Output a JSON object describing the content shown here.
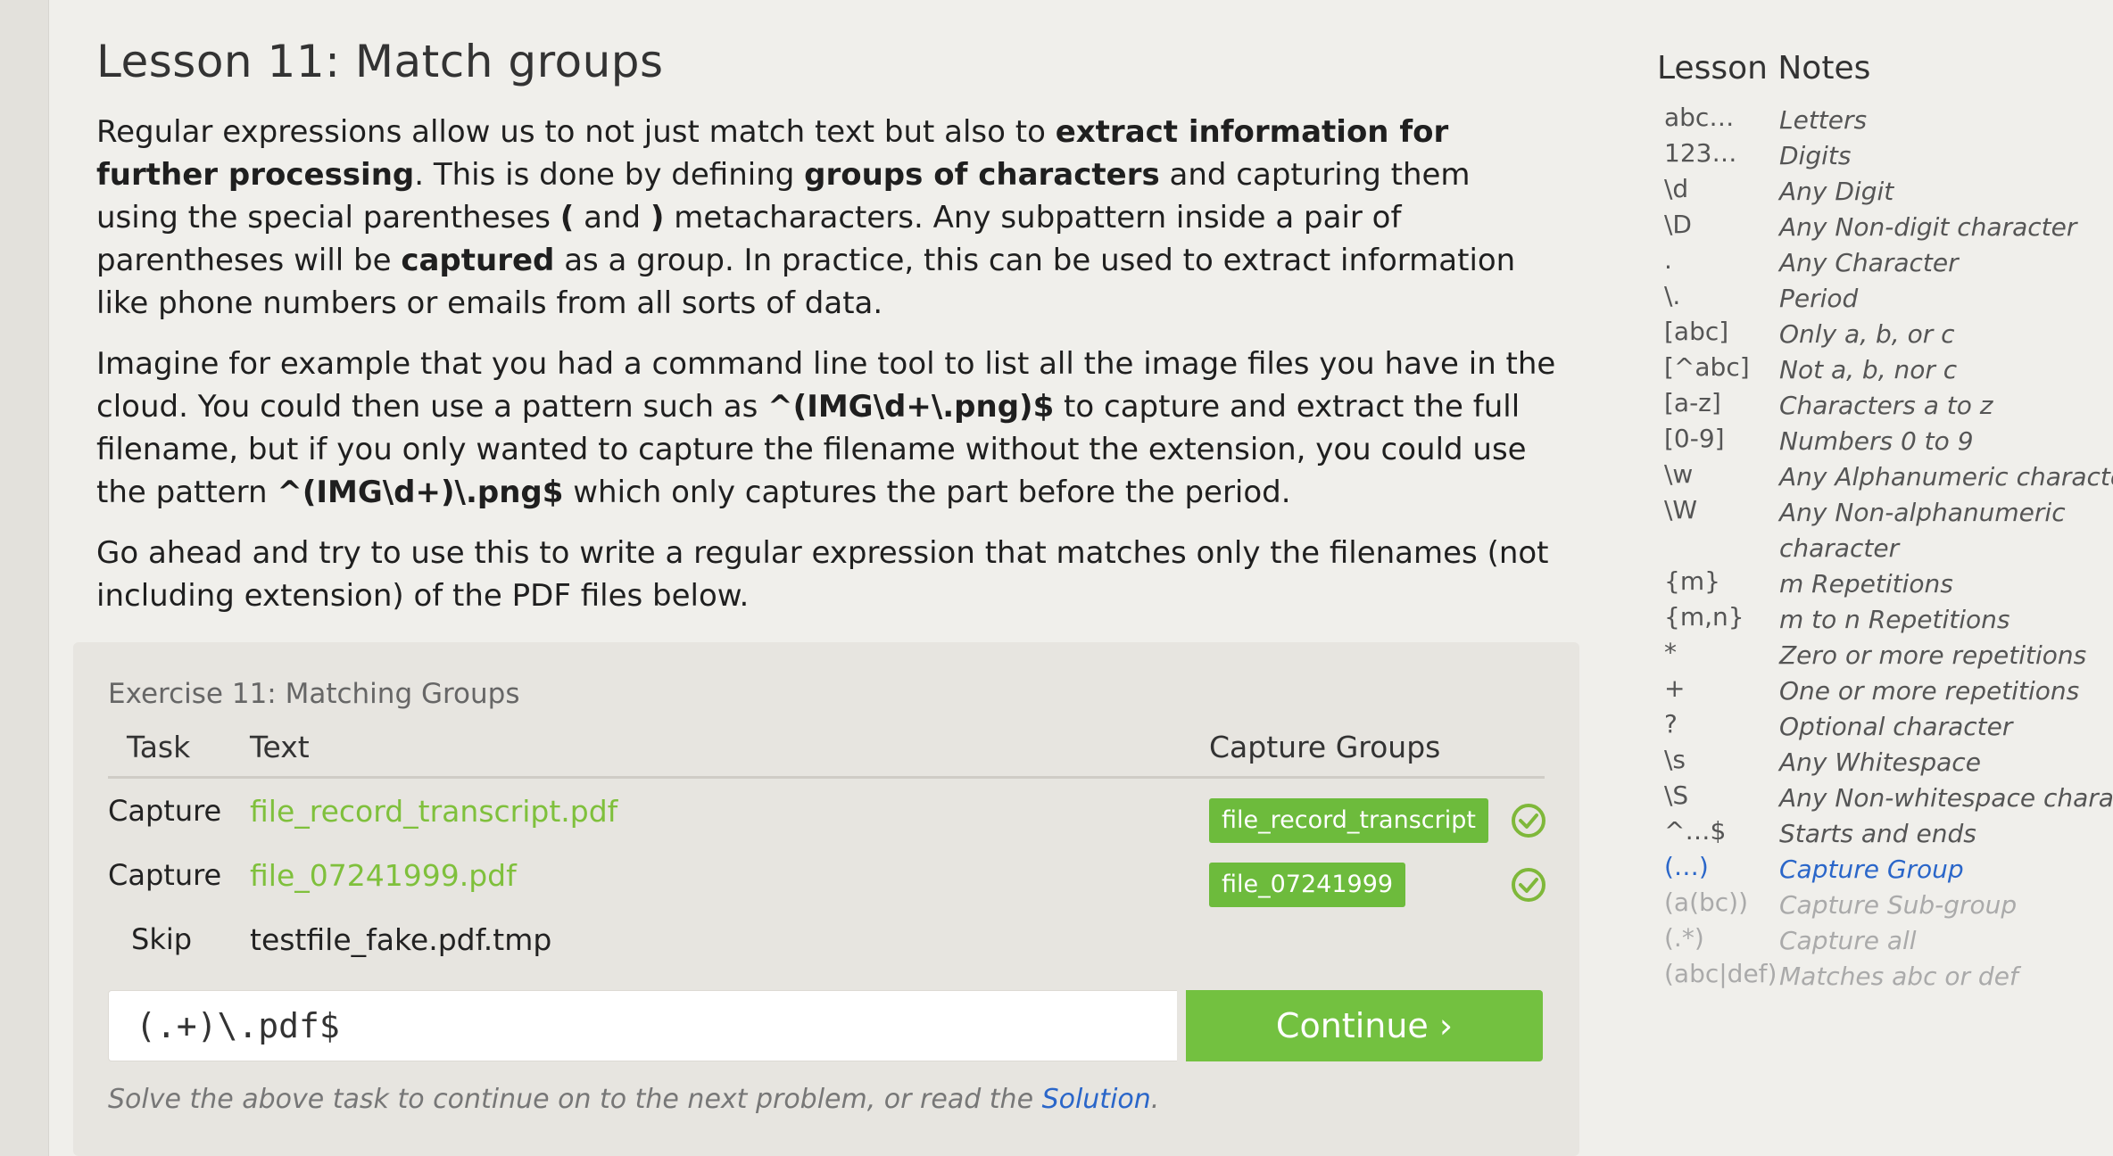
{
  "lesson": {
    "title": "Lesson 11: Match groups",
    "paragraph1": [
      {
        "t": "Regular expressions allow us to not just match text but also to ",
        "b": false
      },
      {
        "t": "extract information for further processing",
        "b": true
      },
      {
        "t": ". This is done by defining ",
        "b": false
      },
      {
        "t": "groups of characters",
        "b": true
      },
      {
        "t": " and capturing them using the special parentheses ",
        "b": false
      },
      {
        "t": "(",
        "b": true
      },
      {
        "t": " and ",
        "b": false
      },
      {
        "t": ")",
        "b": true
      },
      {
        "t": " metacharacters. Any subpattern inside a pair of parentheses will be ",
        "b": false
      },
      {
        "t": "captured",
        "b": true
      },
      {
        "t": " as a group. In practice, this can be used to extract information like phone numbers or emails from all sorts of data.",
        "b": false
      }
    ],
    "paragraph2": [
      {
        "t": "Imagine for example that you had a command line tool to list all the image files you have in the cloud. You could then use a pattern such as ",
        "b": false
      },
      {
        "t": "^(IMG\\d+\\.png)$",
        "b": true
      },
      {
        "t": " to capture and extract the full filename, but if you only wanted to capture the filename without the extension, you could use the pattern ",
        "b": false
      },
      {
        "t": "^(IMG\\d+)\\.png$",
        "b": true
      },
      {
        "t": " which only captures the part before the period.",
        "b": false
      }
    ],
    "paragraph3": [
      {
        "t": "Go ahead and try to use this to write a regular expression that matches only the filenames (not including extension) of the PDF files below.",
        "b": false
      }
    ]
  },
  "exercise": {
    "title": "Exercise 11: Matching Groups",
    "headers": {
      "task": "Task",
      "text": "Text",
      "groups": "Capture Groups"
    },
    "rows": [
      {
        "task": "Capture",
        "text": "file_record_transcript.pdf",
        "group": "file_record_transcript",
        "status": "ok"
      },
      {
        "task": "Capture",
        "text": "file_07241999.pdf",
        "group": "file_07241999",
        "status": "ok"
      },
      {
        "task": "Skip",
        "text": "testfile_fake.pdf.tmp",
        "group": "",
        "status": "none"
      }
    ],
    "input_value": "(.+)\\.pdf$",
    "continue_label": "Continue ›",
    "hint_before": "Solve the above task to continue on to the next problem, or read the ",
    "hint_link": "Solution",
    "hint_after": "."
  },
  "notes": {
    "title": "Lesson Notes",
    "items": [
      {
        "code": "abc…",
        "desc": "Letters",
        "state": "normal"
      },
      {
        "code": "123…",
        "desc": "Digits",
        "state": "normal"
      },
      {
        "code": "\\d",
        "desc": "Any Digit",
        "state": "normal"
      },
      {
        "code": "\\D",
        "desc": "Any Non-digit character",
        "state": "normal"
      },
      {
        "code": ".",
        "desc": "Any Character",
        "state": "normal"
      },
      {
        "code": "\\.",
        "desc": "Period",
        "state": "normal"
      },
      {
        "code": "[abc]",
        "desc": "Only a, b, or c",
        "state": "normal"
      },
      {
        "code": "[^abc]",
        "desc": "Not a, b, nor c",
        "state": "normal"
      },
      {
        "code": "[a-z]",
        "desc": "Characters a to z",
        "state": "normal"
      },
      {
        "code": "[0-9]",
        "desc": "Numbers 0 to 9",
        "state": "normal"
      },
      {
        "code": "\\w",
        "desc": "Any Alphanumeric character",
        "state": "normal"
      },
      {
        "code": "\\W",
        "desc": "Any Non-alphanumeric character",
        "state": "normal",
        "tall": true
      },
      {
        "code": "{m}",
        "desc": "m Repetitions",
        "state": "normal"
      },
      {
        "code": "{m,n}",
        "desc": "m to n Repetitions",
        "state": "normal"
      },
      {
        "code": "*",
        "desc": "Zero or more repetitions",
        "state": "normal"
      },
      {
        "code": "+",
        "desc": "One or more repetitions",
        "state": "normal"
      },
      {
        "code": "?",
        "desc": "Optional character",
        "state": "normal"
      },
      {
        "code": "\\s",
        "desc": "Any Whitespace",
        "state": "normal"
      },
      {
        "code": "\\S",
        "desc": "Any Non-whitespace characte",
        "state": "normal"
      },
      {
        "code": "^…$",
        "desc": "Starts and ends",
        "state": "normal"
      },
      {
        "code": "(…)",
        "desc": "Capture Group",
        "state": "active"
      },
      {
        "code": "(a(bc))",
        "desc": "Capture Sub-group",
        "state": "future"
      },
      {
        "code": "(.*)",
        "desc": "Capture all",
        "state": "future"
      },
      {
        "code": "(abc|def)",
        "desc": "Matches abc or def",
        "state": "future"
      }
    ]
  },
  "colors": {
    "accent_green": "#73c140",
    "link_blue": "#2a66c9",
    "badge_green": "#6dbb3c"
  }
}
